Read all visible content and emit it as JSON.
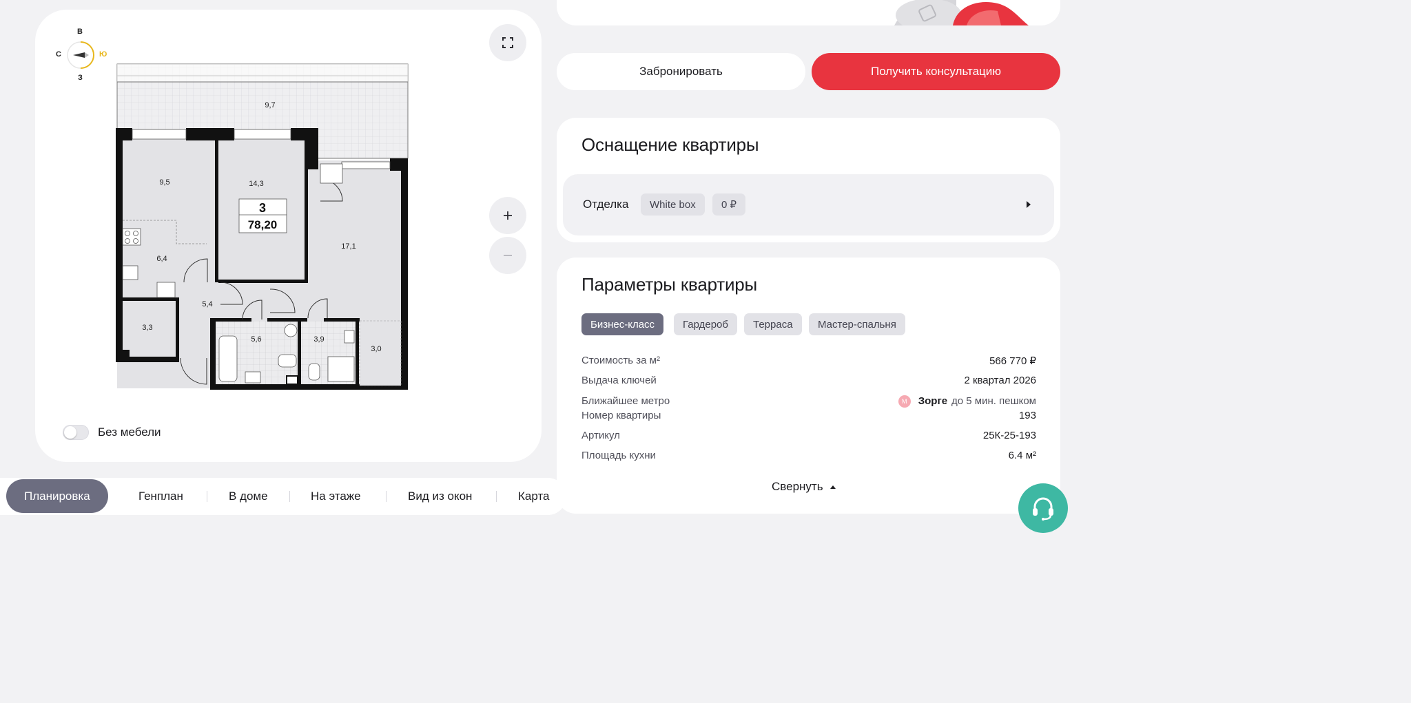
{
  "plan": {
    "compass": {
      "north": "В",
      "west": "С",
      "south_label": "Ю",
      "east": "З"
    },
    "rooms": {
      "terrace": "9,7",
      "room_a": "9,5",
      "room_b": "14,3",
      "kitchen": "6,4",
      "hall": "5,4",
      "storage": "3,3",
      "bath": "5,6",
      "wc": "3,9",
      "living": "17,1",
      "closet": "3,0"
    },
    "badge": {
      "rooms_count": "3",
      "area": "78,20"
    },
    "no_furniture_label": "Без мебели",
    "icons": {
      "fullscreen": "fullscreen-icon",
      "zoom_in": "plus-icon",
      "zoom_out": "minus-icon"
    }
  },
  "tabs": [
    {
      "label": "Планировка",
      "active": true
    },
    {
      "label": "Генплан"
    },
    {
      "label": "В доме"
    },
    {
      "label": "На этаже"
    },
    {
      "label": "Вид из окон"
    },
    {
      "label": "Карта"
    }
  ],
  "actions": {
    "book_label": "Забронировать",
    "consult_label": "Получить консультацию"
  },
  "equipment": {
    "title": "Оснащение квартиры",
    "finish_label": "Отделка",
    "finish_type": "White box",
    "finish_price": "0 ₽"
  },
  "params": {
    "title": "Параметры квартиры",
    "tags": [
      "Бизнес-класс",
      "Гардероб",
      "Терраса",
      "Мастер-спальня"
    ],
    "rows": {
      "price_per_m2": {
        "label": "Стоимость за м²",
        "value": "566 770 ₽"
      },
      "keys": {
        "label": "Выдача ключей",
        "value": "2 квартал 2026"
      },
      "metro": {
        "label": "Ближайшее метро",
        "station": "Зорге",
        "distance": "до 5 мин. пешком",
        "metro_icon_letter": "М"
      },
      "number": {
        "label": "Номер квартиры",
        "value": "193"
      },
      "sku": {
        "label": "Артикул",
        "value": "25К-25-193"
      },
      "kitchen_area": {
        "label": "Площадь кухни",
        "value": "6.4 м²"
      }
    },
    "collapse_label": "Свернуть"
  },
  "colors": {
    "accent_red": "#e8343f",
    "tab_active": "#6c6d80",
    "support_green": "#3eb8a3",
    "compass_south": "#e8b71c"
  }
}
